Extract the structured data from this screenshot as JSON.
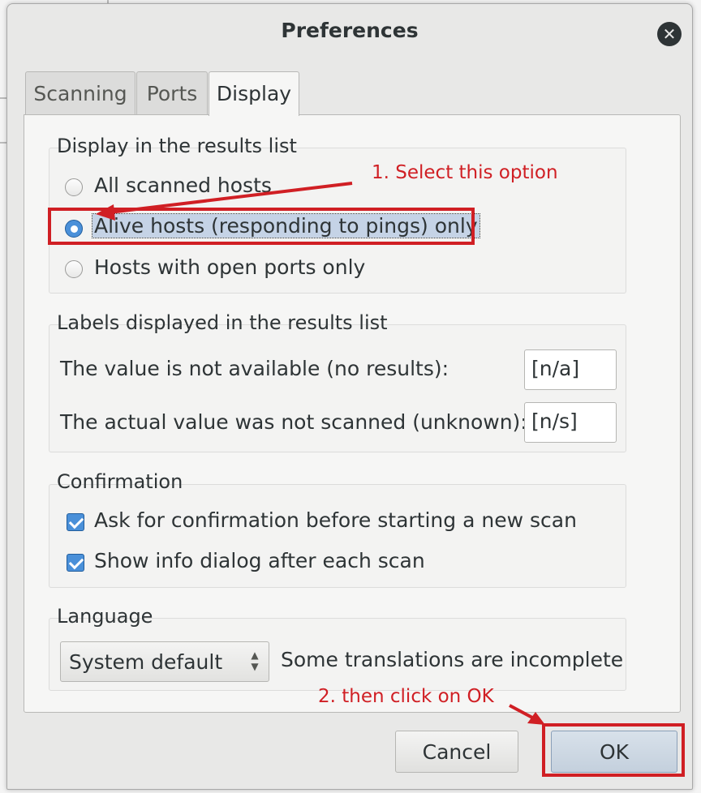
{
  "dialog": {
    "title": "Preferences",
    "close_symbol": "✕"
  },
  "tabs": [
    {
      "label": "Scanning",
      "active": false
    },
    {
      "label": "Ports",
      "active": false
    },
    {
      "label": "Display",
      "active": true
    }
  ],
  "display_group": {
    "title": "Display in the results list",
    "options": [
      {
        "label": "All scanned hosts",
        "checked": false
      },
      {
        "label": "Alive hosts (responding to pings) only",
        "checked": true
      },
      {
        "label": "Hosts with open ports only",
        "checked": false
      }
    ]
  },
  "labels_group": {
    "title": "Labels displayed in the results list",
    "not_available_label": "The value is not available (no results):",
    "not_available_value": "[n/a]",
    "not_scanned_label": "The actual value was not scanned (unknown):",
    "not_scanned_value": "[n/s]"
  },
  "confirmation_group": {
    "title": "Confirmation",
    "ask_confirmation": "Ask for confirmation before starting a new scan",
    "show_info_dialog": "Show info dialog after each scan"
  },
  "language_group": {
    "title": "Language",
    "selected": "System default",
    "note": "Some translations are incomplete"
  },
  "buttons": {
    "cancel": "Cancel",
    "ok": "OK"
  },
  "annotations": {
    "step1": "1. Select this option",
    "step2": "2. then click on OK",
    "color": "#d01f24"
  }
}
